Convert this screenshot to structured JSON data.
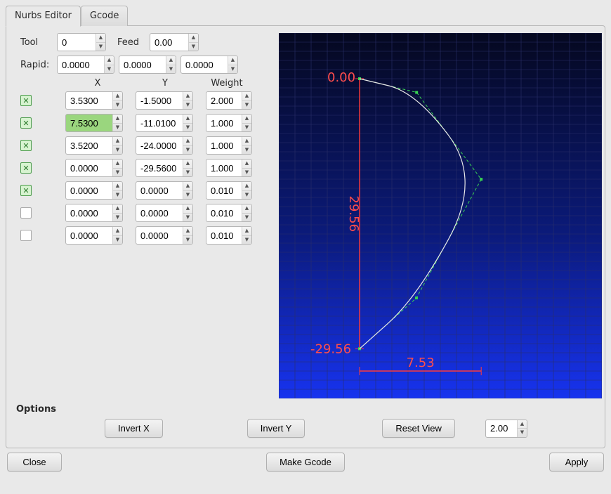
{
  "tabs": {
    "nurbs": "Nurbs Editor",
    "gcode": "Gcode"
  },
  "labels": {
    "tool": "Tool",
    "feed": "Feed",
    "rapid": "Rapid:",
    "options": "Options"
  },
  "tool_value": "0",
  "feed_value": "0.00",
  "rapid": {
    "x": "0.0000",
    "y": "0.0000",
    "z": "0.0000"
  },
  "columns": {
    "x": "X",
    "y": "Y",
    "w": "Weight"
  },
  "rows": [
    {
      "enabled": true,
      "x": "3.5300",
      "y": "-1.5000",
      "w": "2.000"
    },
    {
      "enabled": true,
      "x": "7.5300",
      "y": "-11.0100",
      "w": "1.000",
      "x_highlight": true
    },
    {
      "enabled": true,
      "x": "3.5200",
      "y": "-24.0000",
      "w": "1.000"
    },
    {
      "enabled": true,
      "x": "0.0000",
      "y": "-29.5600",
      "w": "1.000"
    },
    {
      "enabled": true,
      "x": "0.0000",
      "y": "0.0000",
      "w": "0.010"
    },
    {
      "enabled": false,
      "x": "0.0000",
      "y": "0.0000",
      "w": "0.010"
    },
    {
      "enabled": false,
      "x": "0.0000",
      "y": "0.0000",
      "w": "0.010"
    }
  ],
  "buttons": {
    "invert_x": "Invert X",
    "invert_y": "Invert Y",
    "reset_view": "Reset View",
    "close": "Close",
    "make_gcode": "Make Gcode",
    "apply": "Apply"
  },
  "options_spin": "2.00",
  "chart_data": {
    "type": "line",
    "title": "",
    "xlabel": "",
    "ylabel": "",
    "x_range": [
      -5,
      15
    ],
    "y_range": [
      -35,
      5
    ],
    "grid": true,
    "annotations": [
      {
        "text": "0.00",
        "x": 0,
        "y": 0
      },
      {
        "text": "29.56",
        "x": 0,
        "y": -14.78,
        "orientation": "vertical"
      },
      {
        "text": "-29.56",
        "x": 0,
        "y": -29.56
      },
      {
        "text": "7.53",
        "x": 3.765,
        "y": -32
      }
    ],
    "control_points": [
      {
        "x": 0.0,
        "y": 0.0
      },
      {
        "x": 3.53,
        "y": -1.5
      },
      {
        "x": 7.53,
        "y": -11.01
      },
      {
        "x": 3.52,
        "y": -24.0
      },
      {
        "x": 0.0,
        "y": -29.56
      }
    ],
    "dimension_lines": {
      "vertical": {
        "x": 0,
        "y1": 0,
        "y2": -29.56
      },
      "horizontal": {
        "y": -32,
        "x1": 0,
        "x2": 7.53
      }
    }
  }
}
